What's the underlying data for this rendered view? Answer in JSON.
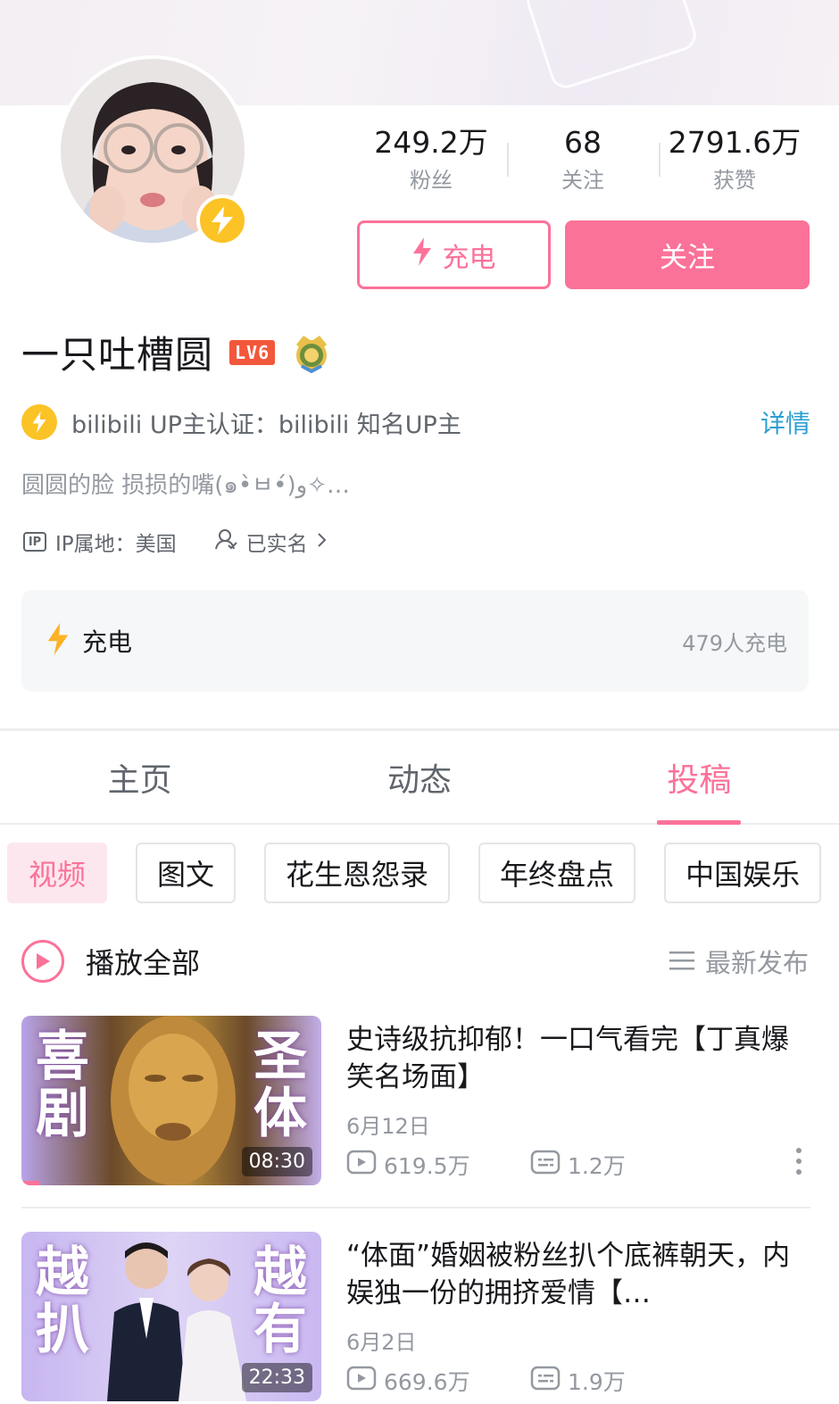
{
  "profile": {
    "username": "一只吐槽圆",
    "level_badge": "LV6",
    "stats": [
      {
        "value": "249.2万",
        "label": "粉丝"
      },
      {
        "value": "68",
        "label": "关注"
      },
      {
        "value": "2791.6万",
        "label": "获赞"
      }
    ],
    "charge_button_label": "充电",
    "follow_button_label": "关注",
    "cert_text": "bilibili UP主认证：bilibili 知名UP主",
    "cert_detail_label": "详情",
    "bio": "圆圆的脸 损损的嘴(๑•̀ㅂ•́)و✧…",
    "ip_icon_text": "IP",
    "ip_location": "IP属地：美国",
    "verified_label": "已实名",
    "charge_card_label": "充电",
    "charge_count": "479人充电"
  },
  "tabs": [
    {
      "label": "主页",
      "active": false
    },
    {
      "label": "动态",
      "active": false
    },
    {
      "label": "投稿",
      "active": true
    }
  ],
  "chips": [
    "视频",
    "图文",
    "花生恩怨录",
    "年终盘点",
    "中国娱乐"
  ],
  "list_header": {
    "play_all_label": "播放全部",
    "sort_label": "最新发布"
  },
  "videos": [
    {
      "title": "史诗级抗抑郁！一口气看完【丁真爆笑名场面】",
      "date": "6月12日",
      "views": "619.5万",
      "danmaku": "1.2万",
      "duration": "08:30",
      "thumb_left": "喜剧",
      "thumb_right": "圣体",
      "watched_fraction": 0.06
    },
    {
      "title": "“体面”婚姻被粉丝扒个底裤朝天，内娱独一份的拥挤爱情【…",
      "date": "6月2日",
      "views": "669.6万",
      "danmaku": "1.9万",
      "duration": "22:33",
      "thumb_left": "越扒",
      "thumb_right": "越有"
    }
  ],
  "colors": {
    "accent": "#fb7299",
    "link": "#2b9fd1",
    "charge_yellow": "#fbc325",
    "level_red": "#f3573b"
  },
  "icons": [
    "lightning-icon",
    "ip-icon",
    "verified-user-icon",
    "chevron-right-icon",
    "play-circle-icon",
    "sort-list-icon",
    "play-count-icon",
    "danmaku-icon",
    "more-vertical-icon"
  ]
}
